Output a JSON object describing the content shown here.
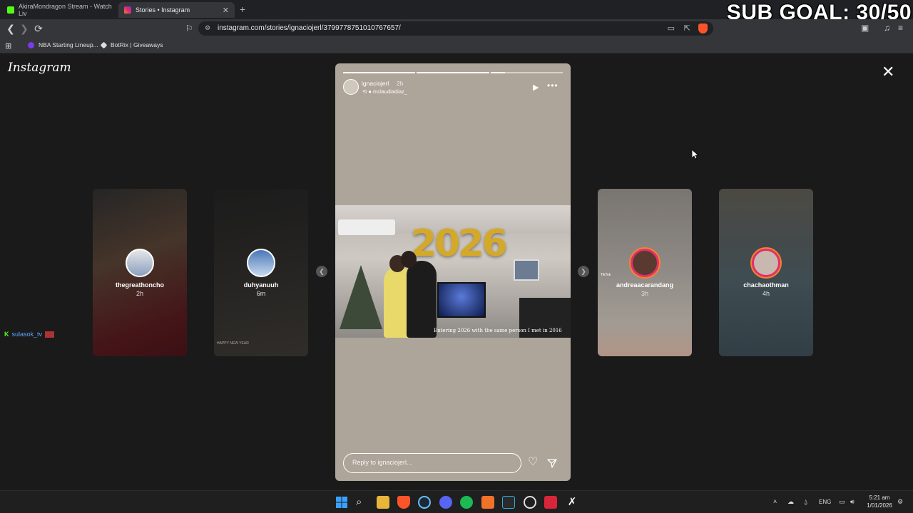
{
  "tabs": [
    {
      "title": "AkiraMondragon Stream - Watch Liv",
      "active": false
    },
    {
      "title": "Stories • Instagram",
      "active": true
    }
  ],
  "overlay": {
    "sub_goal": "SUB GOAL: 30/50"
  },
  "address_bar": {
    "url": "instagram.com/stories/ignaciojerl/3799778751010767657/"
  },
  "bookmarks": [
    {
      "label": "NBA Starting Lineup..."
    },
    {
      "label": "BotRix | Giveaways"
    }
  ],
  "instagram": {
    "logo": "Instagram",
    "close_symbol": "✕",
    "stories_left": [
      {
        "username": "thegreathoncho",
        "time": "2h"
      },
      {
        "username": "duhyanuuh",
        "time": "6m",
        "caption": "HAPPY NEW YEAR"
      }
    ],
    "stories_right": [
      {
        "username": "andreaacarandang",
        "time": "3h",
        "caption": "TikTok"
      },
      {
        "username": "chachaothman",
        "time": "4h"
      }
    ],
    "active_story": {
      "username": "ignaciojerl",
      "time": "2h",
      "reshared_from": "mclaudiadiaz_",
      "progress": [
        1.0,
        1.0,
        0.2
      ],
      "photo_caption": "Entering 2026 with the same person I met in 2016",
      "balloon_text": "2026",
      "reply_placeholder": "Reply to ignaciojerl..."
    }
  },
  "chat_overlay": {
    "user": "sulasok_tv"
  },
  "taskbar": {
    "language": "ENG",
    "time": "5:21 am",
    "date": "1/01/2026"
  },
  "colors": {
    "story_bg": "#ada599",
    "page_bg": "#1a1a1a",
    "ring": "#e1306c"
  }
}
